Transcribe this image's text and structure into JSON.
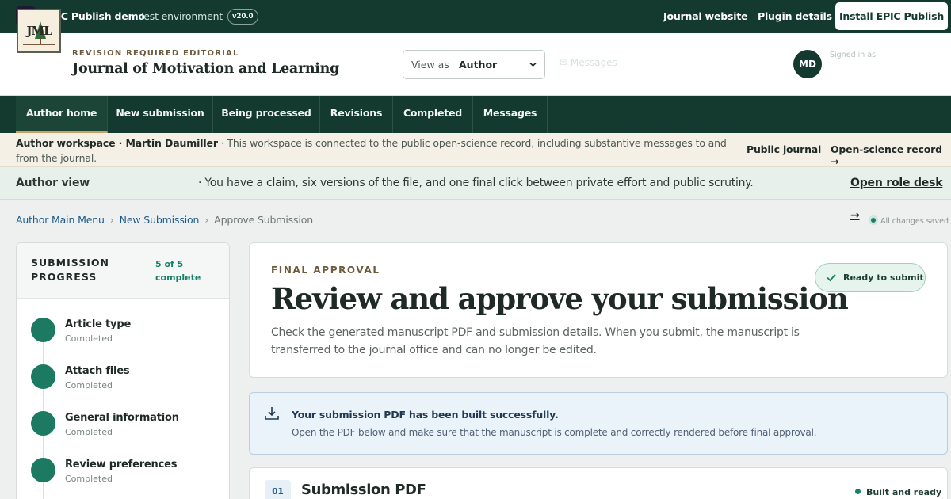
{
  "topbar": {
    "brand": "EPIC Publish demo",
    "environment": "Test environment",
    "version": "v20.0",
    "journal_website": "Journal website",
    "plugin_details": "Plugin details",
    "install_button": "Install EPIC Publish"
  },
  "journal": {
    "logo_text": "JML",
    "overline": "REVISION REQUIRED EDITORIAL",
    "title": "Journal of Motivation and Learning"
  },
  "view_as": {
    "label": "View as",
    "value": "Author"
  },
  "messages_link": "✉ Messages",
  "user": {
    "initials": "MD",
    "signed_in_label": "Signed in as"
  },
  "nav": {
    "tabs": [
      {
        "label": "Author home",
        "active": true
      },
      {
        "label": "New submission",
        "active": false
      },
      {
        "label": "Being processed",
        "active": false
      },
      {
        "label": "Revisions",
        "active": false
      },
      {
        "label": "Completed",
        "active": false
      },
      {
        "label": "Messages",
        "active": false
      }
    ]
  },
  "workspace": {
    "title": "Author workspace · Martin Daumiller",
    "text": " · This workspace is connected to the public open-science record, including substantive messages to and from the journal.",
    "public_journal": "Public journal",
    "open_science": "Open-science record →"
  },
  "author_view": {
    "title": "Author view",
    "message": "· You have a claim, six versions of the file, and one final click between private effort and public scrutiny.",
    "link": "Open role desk →"
  },
  "breadcrumb": {
    "items": [
      "Author Main Menu",
      "New Submission",
      "Approve Submission"
    ],
    "saved": "All changes saved"
  },
  "progress": {
    "title": "SUBMISSION PROGRESS",
    "count": "5 of 5 complete",
    "steps": [
      {
        "name": "Article type",
        "status": "Completed"
      },
      {
        "name": "Attach files",
        "status": "Completed"
      },
      {
        "name": "General information",
        "status": "Completed"
      },
      {
        "name": "Review preferences",
        "status": "Completed"
      }
    ]
  },
  "approval": {
    "eyebrow": "FINAL APPROVAL",
    "heading": "Review and approve your submission",
    "description": "Check the generated manuscript PDF and submission details. When you submit, the manuscript is transferred to the journal office and can no longer be edited.",
    "badge": "Ready to submit"
  },
  "notice": {
    "title": "Your submission PDF has been built successfully.",
    "text": "Open the PDF below and make sure that the manuscript is complete and correctly rendered before final approval."
  },
  "section": {
    "number": "01",
    "title": "Submission PDF",
    "status": "Built and ready"
  },
  "colors": {
    "primary": "#143a30",
    "accent": "#16806a",
    "gold": "#c8a163",
    "link": "#1d5a8a"
  }
}
